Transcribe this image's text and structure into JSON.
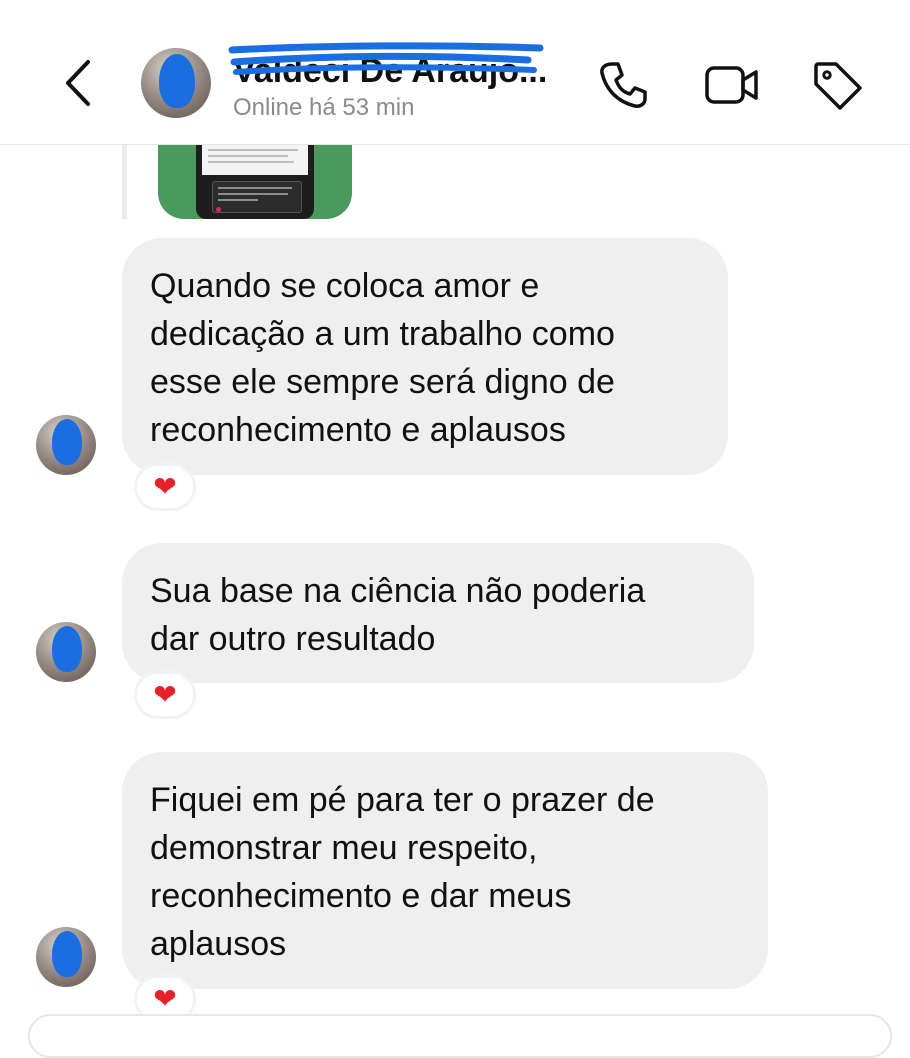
{
  "header": {
    "contact_name": "Valdeci De Araujo...",
    "status": "Online há 53 min",
    "icons": {
      "back": "chevron-left-icon",
      "call": "phone-icon",
      "video": "video-camera-icon",
      "tag": "tag-icon"
    }
  },
  "colors": {
    "bubble_bg": "#efefef",
    "redaction_blue": "#1a6ee0",
    "heart": "#e8202a",
    "status_grey": "#8a8a8a"
  },
  "messages": [
    {
      "text": "Quando se coloca amor e\ndedicação a um trabalho como\nesse ele sempre será digno de\nreconhecimento e aplausos",
      "reaction": "❤"
    },
    {
      "text": "Sua base na ciência não poderia\ndar outro resultado",
      "reaction": "❤"
    },
    {
      "text": "Fiquei em pé para ter o prazer de\ndemonstrar meu respeito,\nreconhecimento e dar meus\naplausos",
      "reaction": "❤"
    }
  ]
}
